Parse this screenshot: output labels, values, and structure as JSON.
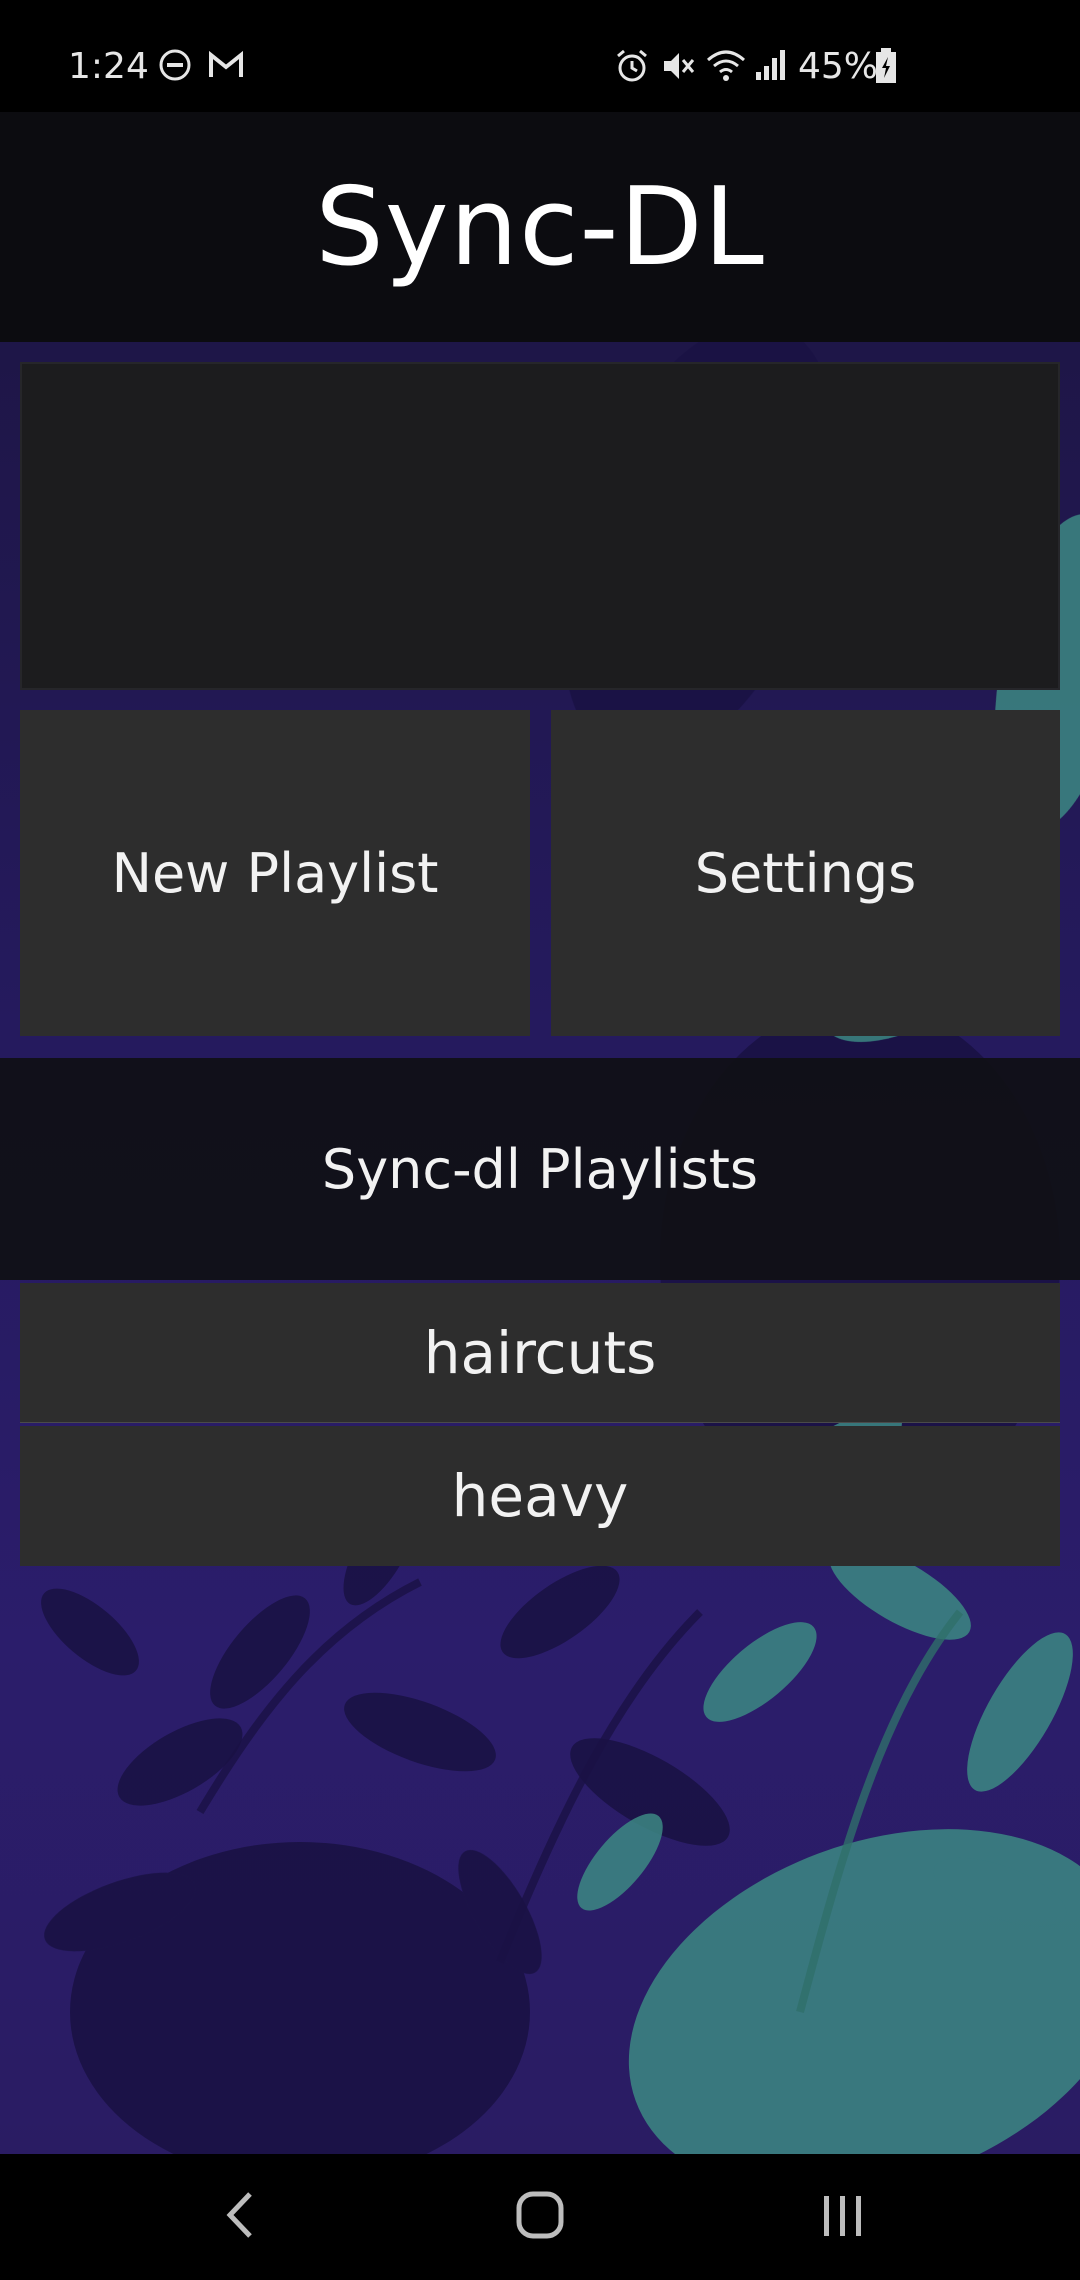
{
  "status_bar": {
    "time": "1:24",
    "battery_percent": "45%",
    "left_icons": [
      "do-not-disturb-icon",
      "gmail-icon"
    ],
    "right_icons": [
      "alarm-icon",
      "mute-icon",
      "wifi-icon",
      "signal-icon",
      "battery-charging-icon"
    ]
  },
  "app": {
    "title": "Sync-DL"
  },
  "actions": {
    "new_playlist_label": "New Playlist",
    "settings_label": "Settings"
  },
  "playlists": {
    "header": "Sync-dl Playlists",
    "items": [
      {
        "label": "haircuts"
      },
      {
        "label": "heavy"
      }
    ]
  },
  "nav_bar": {
    "icons": [
      "back-icon",
      "home-icon",
      "recents-icon"
    ]
  },
  "colors": {
    "app_bar": "#0c0c10",
    "panel": "#2d2d2d",
    "banner": "#1c1c1e",
    "wallpaper": "#251a5e",
    "foliage": "#3d8a84"
  }
}
